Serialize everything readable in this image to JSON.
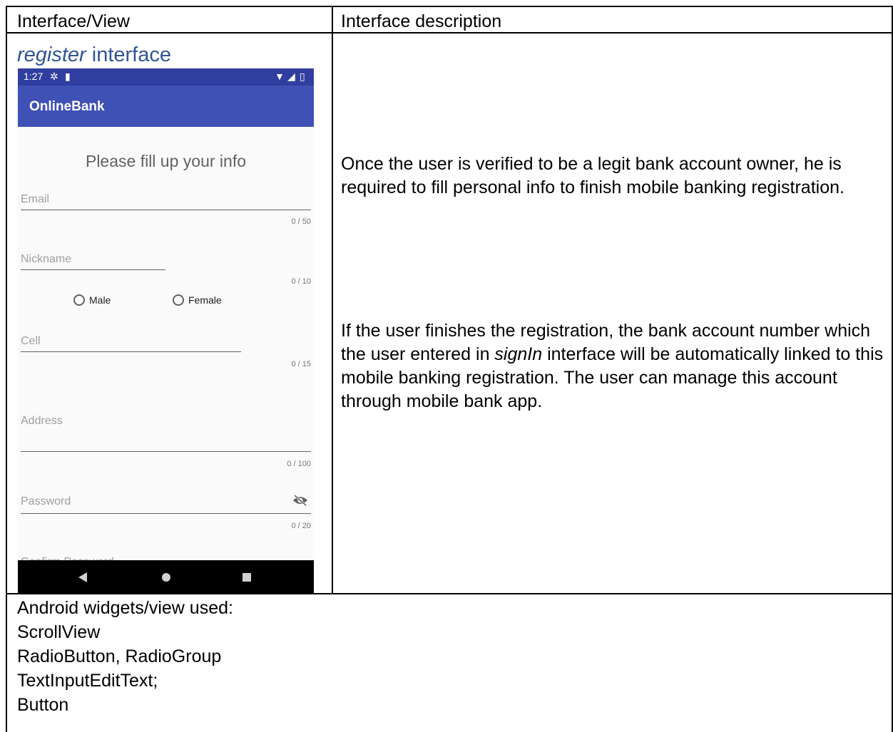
{
  "table": {
    "col1_header": "Interface/View",
    "col2_header": "Interface description"
  },
  "screen_title": {
    "italic": "register",
    "rest": " interface"
  },
  "phone": {
    "status_time": "1:27",
    "app_title": "OnlineBank",
    "heading": "Please fill up your info",
    "fields": {
      "email": {
        "label": "Email",
        "counter": "0 / 50"
      },
      "nickname": {
        "label": "Nickname",
        "counter": "0 / 10"
      },
      "cell": {
        "label": "Cell",
        "counter": "0 / 15"
      },
      "address": {
        "label": "Address",
        "counter": "0 / 100"
      },
      "password": {
        "label": "Password",
        "counter": "0 / 20"
      },
      "confirm_password": {
        "label": "Confirm Password"
      }
    },
    "radio_male": "Male",
    "radio_female": "Female",
    "colors": {
      "status_bar": "#303f9f",
      "app_bar": "#3f51b5"
    }
  },
  "description": {
    "para1": "Once the user is verified to be a legit bank account owner, he is required to fill personal info to finish mobile banking registration.",
    "para2_a": "If the user finishes the registration, the bank account number which the user entered in ",
    "para2_italic": "signIn",
    "para2_b": " interface will be automatically linked to this mobile banking registration. The user can manage this account through mobile bank app."
  },
  "widgets": {
    "title": "Android widgets/view used:",
    "items": [
      "ScrollView",
      "RadioButton, RadioGroup",
      "TextInputEditText;",
      "Button"
    ]
  }
}
